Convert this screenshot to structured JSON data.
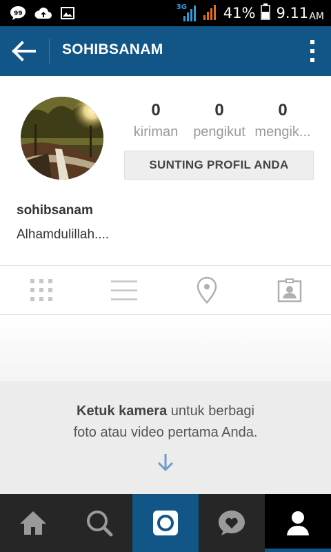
{
  "status_bar": {
    "network_label": "3G",
    "battery_percent": "41%",
    "time": "9.11",
    "ampm": "AM"
  },
  "app_bar": {
    "title": "SOHIBSANAM"
  },
  "profile": {
    "username": "sohibsanam",
    "bio": "Alhamdulillah....",
    "edit_button_label": "SUNTING PROFIL ANDA",
    "stats": [
      {
        "count": "0",
        "label": "kiriman"
      },
      {
        "count": "0",
        "label": "pengikut"
      },
      {
        "count": "0",
        "label": "mengik..."
      }
    ]
  },
  "tabs": [
    "grid-icon",
    "list-icon",
    "location-pin-icon",
    "tagged-photos-icon"
  ],
  "empty_state": {
    "bold": "Ketuk kamera",
    "line1_rest": " untuk berbagi",
    "line2": "foto atau video pertama Anda."
  },
  "bottom_nav": {
    "items": [
      "home-icon",
      "search-icon",
      "camera-icon",
      "activity-icon",
      "profile-icon"
    ],
    "active": "profile-icon",
    "camera_bg": "#125688",
    "accent_color": "#125688"
  }
}
